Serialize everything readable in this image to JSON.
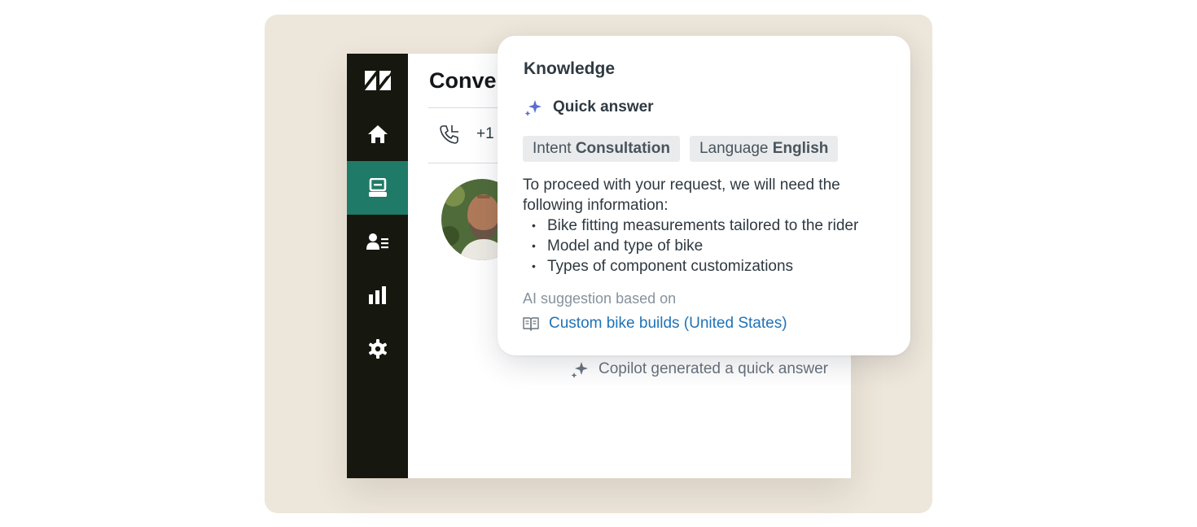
{
  "conversation": {
    "title": "Conve",
    "phone_number": "+1"
  },
  "sidebar": {
    "items": [
      {
        "name": "zendesk-logo",
        "icon": "zendesk-logo"
      },
      {
        "name": "home",
        "icon": "home-icon"
      },
      {
        "name": "inbox",
        "icon": "inbox-icon",
        "active": true
      },
      {
        "name": "customers",
        "icon": "customers-icon"
      },
      {
        "name": "reporting",
        "icon": "bar-chart-icon"
      },
      {
        "name": "settings",
        "icon": "gear-icon"
      }
    ],
    "active_color": "#1f7a68",
    "background": "#16170f"
  },
  "knowledge": {
    "title": "Knowledge",
    "quick_answer_label": "Quick answer",
    "tags": [
      {
        "key": "Intent",
        "value": "Consultation"
      },
      {
        "key": "Language",
        "value": "English"
      }
    ],
    "answer_intro": "To proceed with your request, we will need the following information:",
    "answer_items": [
      "Bike fitting measurements tailored to the rider",
      "Model and type of bike",
      "Types of component customizations"
    ],
    "ai_suggestion_label": "AI suggestion based on",
    "source_link": "Custom bike builds (United States)"
  },
  "copilot_status": "Copilot generated a quick answer",
  "colors": {
    "sparkle": "#5b6fd1",
    "link": "#1f73b7",
    "backdrop": "#ede6da"
  }
}
